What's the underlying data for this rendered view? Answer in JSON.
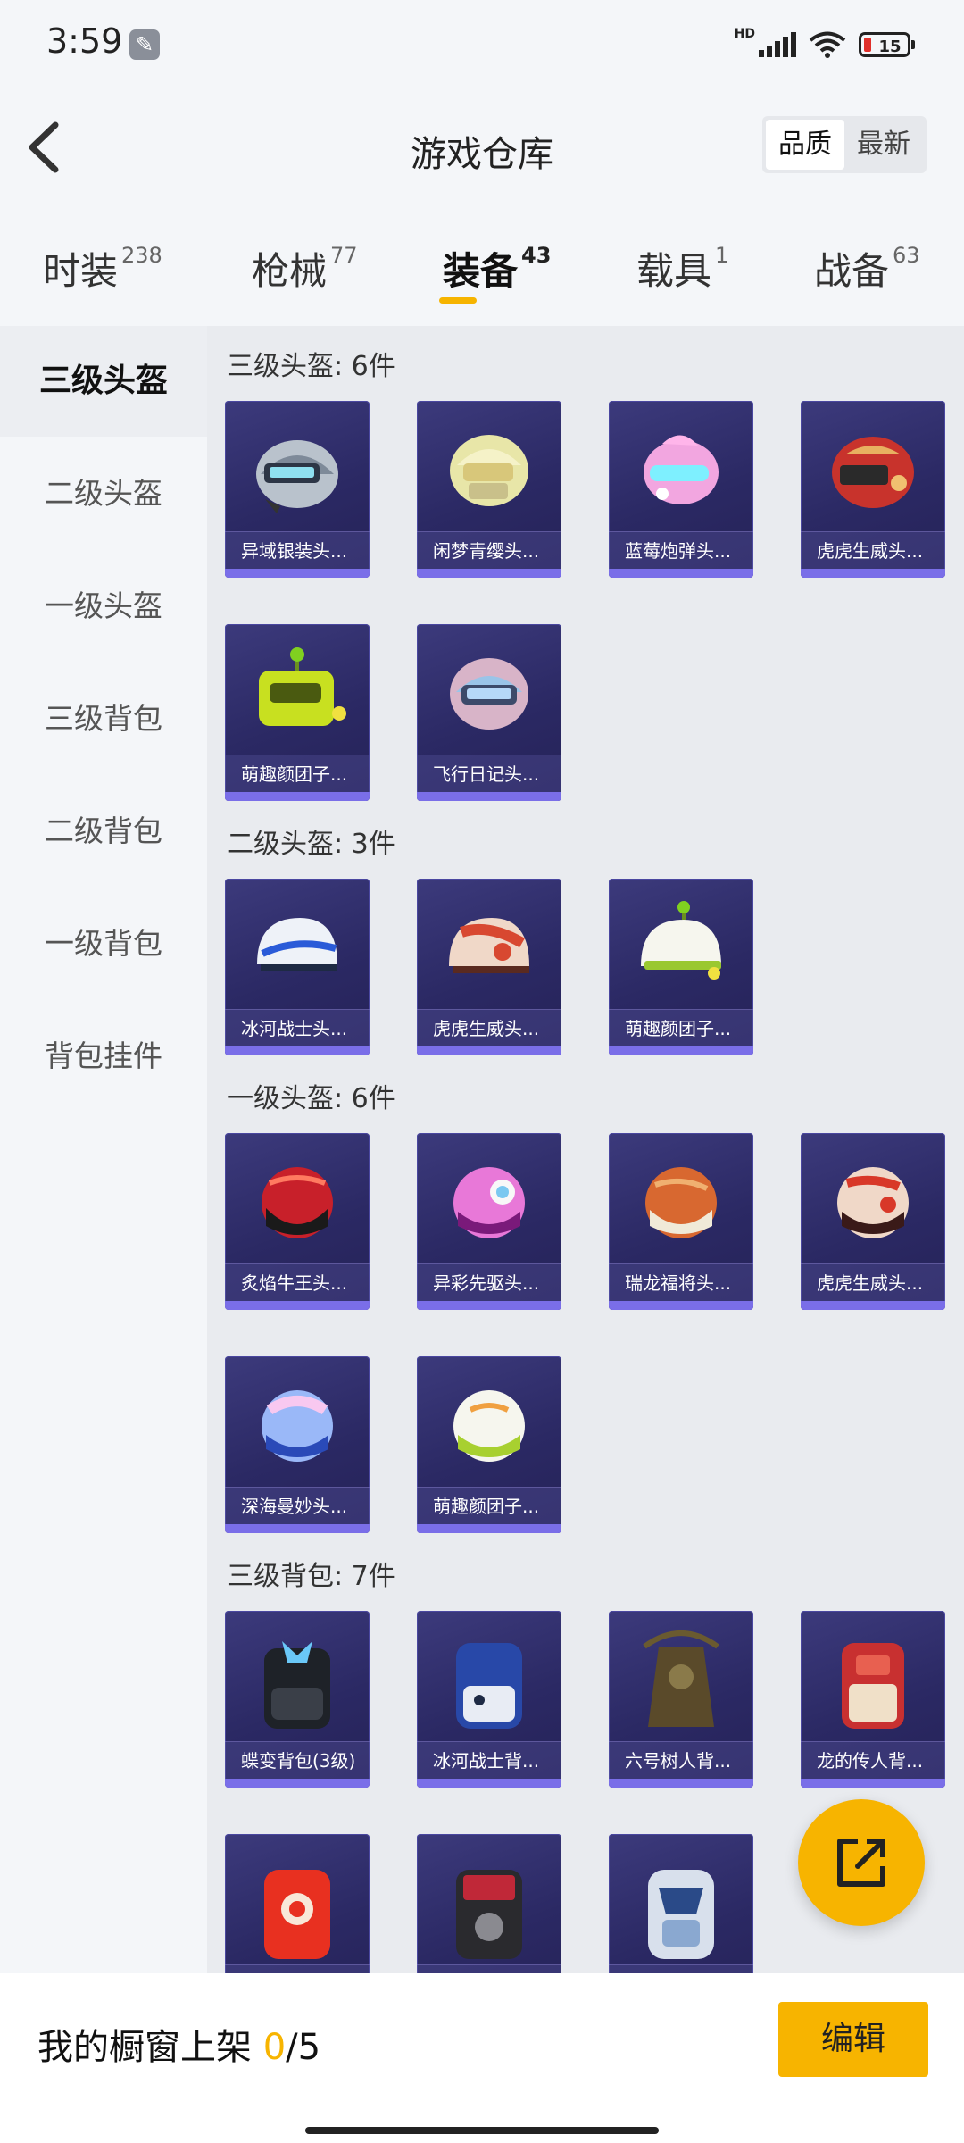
{
  "status": {
    "time": "3:59",
    "network": "HD",
    "battery": "15"
  },
  "header": {
    "title": "游戏仓库",
    "sort_quality": "品质",
    "sort_newest": "最新"
  },
  "tabs": [
    {
      "label": "时装",
      "count": "238"
    },
    {
      "label": "枪械",
      "count": "77"
    },
    {
      "label": "装备",
      "count": "43"
    },
    {
      "label": "载具",
      "count": "1"
    },
    {
      "label": "战备",
      "count": "63"
    }
  ],
  "sidebar": [
    "三级头盔",
    "二级头盔",
    "一级头盔",
    "三级背包",
    "二级背包",
    "一级背包",
    "背包挂件"
  ],
  "sections": [
    {
      "title": "三级头盔: 6件",
      "items": [
        "异域银装头...",
        "闲梦青缨头...",
        "蓝莓炮弹头...",
        "虎虎生威头...",
        "萌趣颜团子...",
        "飞行日记头..."
      ]
    },
    {
      "title": "二级头盔: 3件",
      "items": [
        "冰河战士头...",
        "虎虎生威头...",
        "萌趣颜团子..."
      ]
    },
    {
      "title": "一级头盔: 6件",
      "items": [
        "炙焰牛王头...",
        "异彩先驱头...",
        "瑞龙福将头...",
        "虎虎生威头...",
        "深海曼妙头...",
        "萌趣颜团子..."
      ]
    },
    {
      "title": "三级背包: 7件",
      "items": [
        "蝶变背包(3级)",
        "冰河战士背...",
        "六号树人背...",
        "龙的传人背...",
        "",
        "",
        ""
      ]
    }
  ],
  "bottom": {
    "label": "我的橱窗上架",
    "count": "0",
    "total": "/5",
    "edit": "编辑"
  },
  "colors": {
    "accent": "#f7b400",
    "card_bg": "#2b2964",
    "card_bar": "#7a6ee8"
  },
  "icons": {
    "back": "chevron-left-icon",
    "share": "external-link-icon",
    "wrench": "wrench-icon"
  }
}
